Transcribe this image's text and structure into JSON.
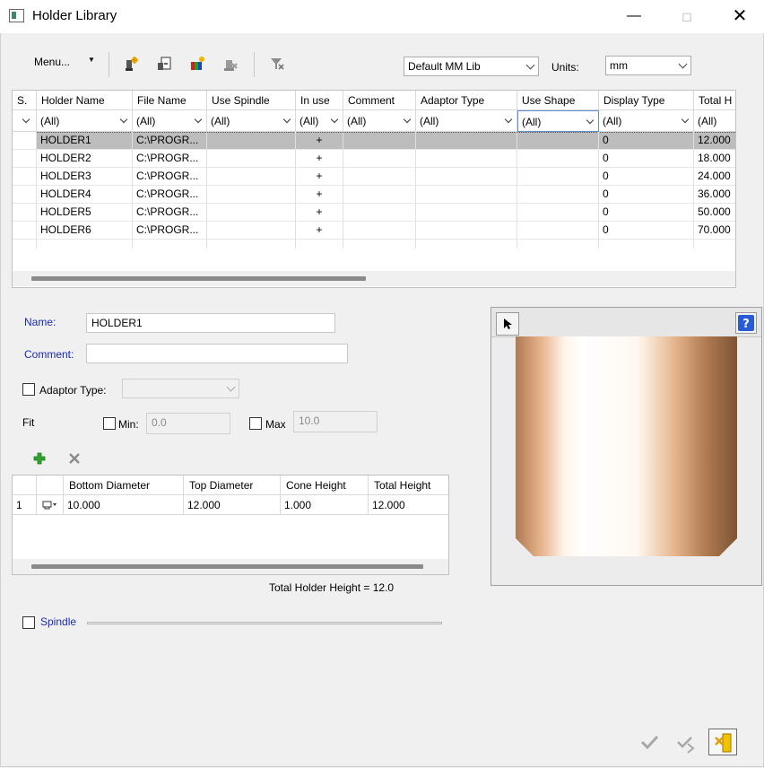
{
  "window": {
    "title": "Holder Library"
  },
  "toolbar": {
    "menu_label": "Menu...",
    "library_value": "Default MM Lib",
    "units_label": "Units:",
    "units_value": "mm"
  },
  "grid": {
    "columns": [
      "S.",
      "Holder Name",
      "File Name",
      "Use Spindle",
      "In use",
      "Comment",
      "Adaptor Type",
      "Use Shape",
      "Display Type",
      "Total H"
    ],
    "filters": [
      "",
      "(All)",
      "(All)",
      "(All)",
      "(All)",
      "(All)",
      "(All)",
      "(All)",
      "(All)",
      "(All)"
    ],
    "rows": [
      {
        "name": "HOLDER1",
        "file": "C:\\PROGR...",
        "in_use": "+",
        "display": "0",
        "total": "12.000"
      },
      {
        "name": "HOLDER2",
        "file": "C:\\PROGR...",
        "in_use": "+",
        "display": "0",
        "total": "18.000"
      },
      {
        "name": "HOLDER3",
        "file": "C:\\PROGR...",
        "in_use": "+",
        "display": "0",
        "total": "24.000"
      },
      {
        "name": "HOLDER4",
        "file": "C:\\PROGR...",
        "in_use": "+",
        "display": "0",
        "total": "36.000"
      },
      {
        "name": "HOLDER5",
        "file": "C:\\PROGR...",
        "in_use": "+",
        "display": "0",
        "total": "50.000"
      },
      {
        "name": "HOLDER6",
        "file": "C:\\PROGR...",
        "in_use": "+",
        "display": "0",
        "total": "70.000"
      }
    ]
  },
  "form": {
    "name_label": "Name:",
    "name_value": "HOLDER1",
    "comment_label": "Comment:",
    "comment_value": "",
    "adaptor_label": "Adaptor Type:",
    "fit_label": "Fit",
    "min_label": "Min:",
    "min_value": "0.0",
    "max_label": "Max",
    "max_value": "10.0"
  },
  "segments": {
    "columns": [
      "Bottom Diameter",
      "Top Diameter",
      "Cone Height",
      "Total Height"
    ],
    "rows": [
      {
        "index": "1",
        "bottom": "10.000",
        "top": "12.000",
        "cone": "1.000",
        "total": "12.000"
      }
    ],
    "total_text": "Total Holder Height = 12.0"
  },
  "spindle": {
    "label": "Spindle"
  }
}
